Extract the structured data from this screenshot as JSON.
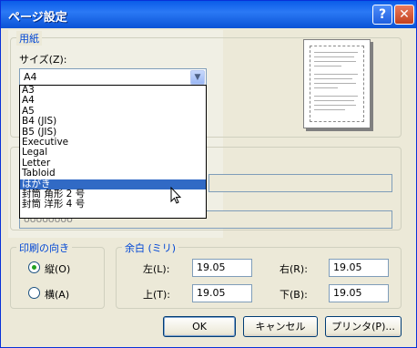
{
  "window": {
    "title": "ページ設定",
    "help_label": "?",
    "close_label": "✕"
  },
  "paper": {
    "group_title": "用紙",
    "size_label": "サイズ(Z):",
    "size_value": "A4",
    "sizes": [
      "A3",
      "A4",
      "A5",
      "B4 (JIS)",
      "B5 (JIS)",
      "Executive",
      "Legal",
      "Letter",
      "Tabloid",
      "はがき",
      "封筒 角形 2 号",
      "封筒 洋形 4 号"
    ],
    "highlighted_size": "はがき",
    "partial_value": "oooooooo"
  },
  "orientation": {
    "group_title": "印刷の向き",
    "portrait_label": "縦(O)",
    "landscape_label": "横(A)",
    "selected": "portrait"
  },
  "margins": {
    "group_title": "余白 (ミリ)",
    "left_label": "左(L):",
    "left_value": "19.05",
    "right_label": "右(R):",
    "right_value": "19.05",
    "top_label": "上(T):",
    "top_value": "19.05",
    "bottom_label": "下(B):",
    "bottom_value": "19.05"
  },
  "buttons": {
    "ok": "OK",
    "cancel": "キャンセル",
    "printer": "プリンタ(P)..."
  },
  "icons": {
    "help": "help-icon",
    "close": "close-icon",
    "dropdown": "chevron-down-icon",
    "cursor": "mouse-pointer-icon"
  },
  "colors": {
    "titlebar": "#0a5ce8",
    "group_title": "#0046d5",
    "selection": "#316ac5",
    "radio_dot": "#21a121"
  }
}
